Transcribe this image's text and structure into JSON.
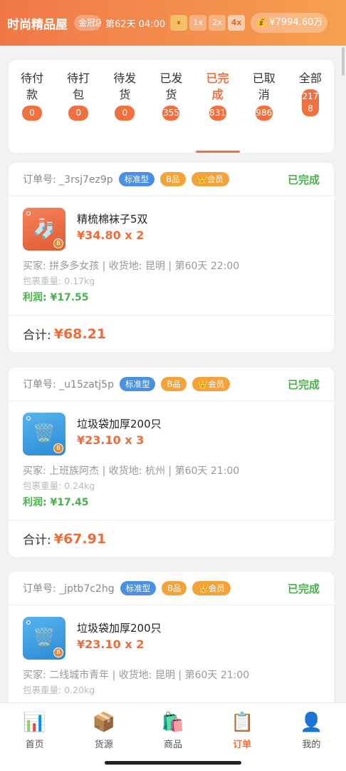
{
  "header": {
    "shop_name": "时尚精品屋",
    "crown_badge": "金冠店",
    "day_time": "第62天 04:00",
    "pause_icon": "⏸",
    "speeds": [
      "1x",
      "2x",
      "4x"
    ],
    "active_speed": "4x",
    "money_icon": "money-bag-icon",
    "money": "¥7994.60万"
  },
  "tabs": [
    {
      "label": "待付款",
      "count": "0"
    },
    {
      "label": "待打包",
      "count": "0"
    },
    {
      "label": "待发货",
      "count": "0"
    },
    {
      "label": "已发货",
      "count": "355"
    },
    {
      "label": "已完成",
      "count": "831",
      "active": true
    },
    {
      "label": "已取消",
      "count": "986"
    },
    {
      "label": "全部",
      "count": "2178"
    }
  ],
  "orders": [
    {
      "order_id": "订单号: _3rsj7ez9p",
      "tags": {
        "type": "标准型",
        "grade": "B品",
        "vip": "👑会员"
      },
      "status": "已完成",
      "product_name": "精梳棉袜子5双",
      "price_qty": "¥34.80 x 2",
      "product_icon": "socks-icon",
      "buyer_line": "买家: 拼多多女孩 | 收货地: 昆明 | 第60天 22:00",
      "weight": "包裹重量: 0.17kg",
      "profit": "利润: ¥17.55",
      "total_label": "合计:",
      "total": "¥68.21"
    },
    {
      "order_id": "订单号: _u15zatj5p",
      "tags": {
        "type": "标准型",
        "grade": "B品",
        "vip": "👑会员"
      },
      "status": "已完成",
      "product_name": "垃圾袋加厚200只",
      "price_qty": "¥23.10 x 3",
      "product_icon": "trash-bin-icon",
      "buyer_line": "买家: 上班族阿杰 | 收货地: 杭州 | 第60天 21:00",
      "weight": "包裹重量: 0.24kg",
      "profit": "利润: ¥17.45",
      "total_label": "合计:",
      "total": "¥67.91"
    },
    {
      "order_id": "订单号: _jptb7c2hg",
      "tags": {
        "type": "标准型",
        "grade": "B品",
        "vip": "👑会员"
      },
      "status": "已完成",
      "product_name": "垃圾袋加厚200只",
      "price_qty": "¥23.10 x 2",
      "product_icon": "trash-bin-icon",
      "buyer_line": "买家: 二线城市青年 | 收货地: 昆明 | 第60天 21:00",
      "weight": "包裹重量: 0.20kg"
    }
  ],
  "nav": [
    {
      "label": "首页",
      "icon": "chart-icon"
    },
    {
      "label": "货源",
      "icon": "package-icon"
    },
    {
      "label": "商品",
      "icon": "shopping-bags-icon"
    },
    {
      "label": "订单",
      "icon": "clipboard-icon",
      "active": true
    },
    {
      "label": "我的",
      "icon": "user-icon"
    }
  ],
  "colors": {
    "accent": "#f07040",
    "success": "#4caf50",
    "tag_blue": "#4a90e2",
    "tag_orange": "#f5a23a"
  }
}
